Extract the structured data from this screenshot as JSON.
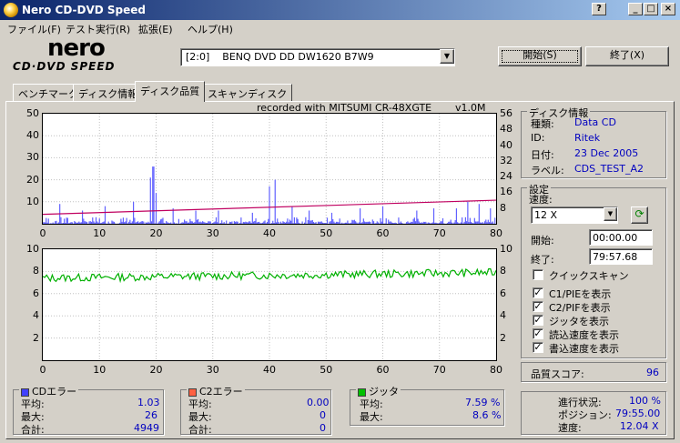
{
  "window": {
    "title": "Nero CD-DVD Speed"
  },
  "title_buttons": [
    "?",
    "_",
    "□",
    "×"
  ],
  "menu": [
    "ファイル(F)",
    "テスト実行(R)",
    "拡張(E)",
    "ヘルプ(H)"
  ],
  "logo": {
    "top": "nero",
    "bottom": "CD·DVD SPEED"
  },
  "drive": {
    "selected": "[2:0]    BENQ DVD DD DW1620 B7W9"
  },
  "buttons": {
    "start": "開始(S)",
    "exit": "終了(X)"
  },
  "tabs": [
    "ベンチマーク",
    "ディスク情報",
    "ディスク品質",
    "スキャンディスク"
  ],
  "active_tab_index": 2,
  "chart_header": {
    "recorded": "recorded with MITSUMI CR-48XGTE",
    "version": "v1.0M"
  },
  "disc_info": {
    "label": "ディスク情報",
    "type_label": "種類:",
    "type": "Data CD",
    "id_label": "ID:",
    "id": "Ritek",
    "date_label": "日付:",
    "date": "23 Dec 2005",
    "label_label": "ラベル:",
    "label_value": "CDS_TEST_A2"
  },
  "settings": {
    "label": "設定",
    "speed_label": "速度:",
    "speed": "12 X",
    "start_label": "開始:",
    "start": "00:00.00",
    "end_label": "終了:",
    "end": "79:57.68",
    "quick_scan": "クイックスキャン",
    "quick_scan_checked": false,
    "options": [
      {
        "label": "C1/PIEを表示",
        "checked": true
      },
      {
        "label": "C2/PIFを表示",
        "checked": true
      },
      {
        "label": "ジッタを表示",
        "checked": true
      },
      {
        "label": "読込速度を表示",
        "checked": true
      },
      {
        "label": "書込速度を表示",
        "checked": true
      }
    ]
  },
  "quality": {
    "label": "品質スコア:",
    "value": "96"
  },
  "progress": {
    "progress_label": "進行状況:",
    "progress": "100 %",
    "position_label": "ポジション:",
    "position": "79:55.00",
    "speed_label": "速度:",
    "speed": "12.04 X"
  },
  "cd_errors": {
    "label": "CDエラー",
    "color": "#4040ff",
    "avg_label": "平均:",
    "avg": "1.03",
    "max_label": "最大:",
    "max": "26",
    "total_label": "合計:",
    "total": "4949"
  },
  "c2_errors": {
    "label": "C2エラー",
    "color": "#ff6040",
    "avg_label": "平均:",
    "avg": "0.00",
    "max_label": "最大:",
    "max": "0",
    "total_label": "合計:",
    "total": "0"
  },
  "jitter": {
    "label": "ジッタ",
    "color": "#00c000",
    "avg_label": "平均:",
    "avg": "7.59 %",
    "max_label": "最大:",
    "max": "8.6 %"
  },
  "chart_data": [
    {
      "type": "bar",
      "x_ticks": [
        0,
        10,
        20,
        30,
        40,
        50,
        60,
        70,
        80
      ],
      "y_left_ticks": [
        10,
        20,
        30,
        40,
        50
      ],
      "y_right_ticks": [
        8,
        16,
        24,
        32,
        40,
        48,
        56
      ],
      "ylim": [
        0,
        50
      ],
      "y2lim": [
        0,
        56
      ],
      "xlim": [
        0,
        80
      ],
      "series": [
        {
          "name": "C1",
          "color": "#6060ff",
          "spikes": [
            [
              3,
              9
            ],
            [
              7,
              6
            ],
            [
              11,
              8
            ],
            [
              16,
              10
            ],
            [
              19,
              21
            ],
            [
              19.5,
              26
            ],
            [
              20,
              14
            ],
            [
              23,
              7
            ],
            [
              27,
              6
            ],
            [
              31,
              6
            ],
            [
              37,
              5
            ],
            [
              40,
              17
            ],
            [
              41,
              20
            ],
            [
              44,
              8
            ],
            [
              47,
              6
            ],
            [
              51,
              5
            ],
            [
              56,
              7
            ],
            [
              60,
              8
            ],
            [
              66,
              6
            ],
            [
              69,
              7
            ],
            [
              73,
              7
            ],
            [
              75,
              10
            ],
            [
              77,
              9
            ],
            [
              79,
              7
            ]
          ]
        },
        {
          "name": "speed",
          "color": "#c00060",
          "y2_start": 4.8,
          "y2_end": 12
        }
      ]
    },
    {
      "type": "line",
      "x_ticks": [
        0,
        10,
        20,
        30,
        40,
        50,
        60,
        70,
        80
      ],
      "y_left_ticks": [
        2,
        4,
        6,
        8,
        10
      ],
      "y_right_ticks": [
        2,
        4,
        6,
        8,
        10
      ],
      "ylim": [
        0,
        10
      ],
      "xlim": [
        0,
        80
      ],
      "series": [
        {
          "name": "Jitter",
          "color": "#00b000",
          "start": 7.4,
          "end": 7.9
        }
      ]
    }
  ]
}
